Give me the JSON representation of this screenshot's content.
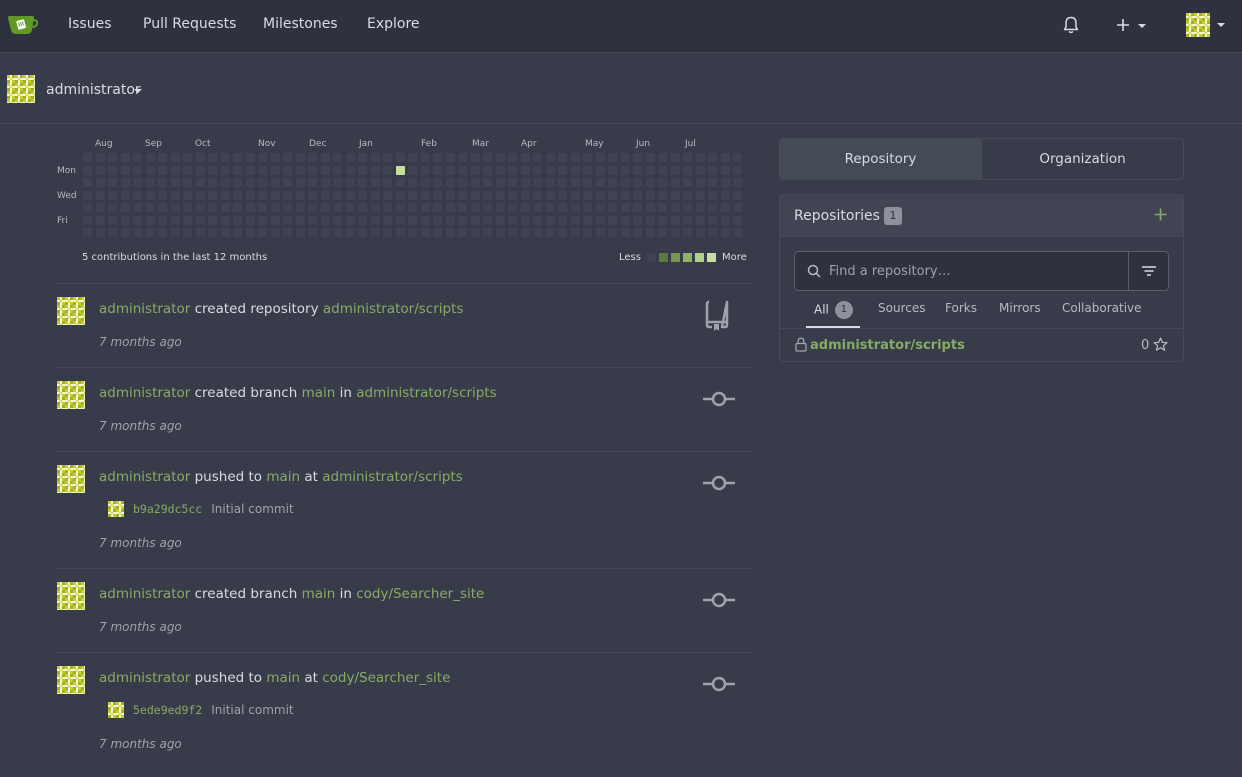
{
  "nav": {
    "items": [
      "Issues",
      "Pull Requests",
      "Milestones",
      "Explore"
    ]
  },
  "context": {
    "user": "administrator"
  },
  "heatmap": {
    "months": [
      "Aug",
      "Sep",
      "Oct",
      "Nov",
      "Dec",
      "Jan",
      "Feb",
      "Mar",
      "Apr",
      "May",
      "Jun",
      "Jul"
    ],
    "days": [
      "Mon",
      "Wed",
      "Fri"
    ],
    "summary": "5 contributions in the last 12 months",
    "less": "Less",
    "more": "More",
    "colors": [
      "#404452",
      "#5c7a3e",
      "#76984f",
      "#90b464",
      "#b0d08a",
      "#c7e09f"
    ],
    "active_cell": {
      "week": 25,
      "day": 1,
      "level": 5
    }
  },
  "feed": [
    {
      "user": "administrator",
      "action": "created repository",
      "target": "administrator/scripts",
      "time": "7 months ago",
      "icon": "repo-icon"
    },
    {
      "user": "administrator",
      "action": "created branch",
      "branch": "main",
      "prep": "in",
      "target": "administrator/scripts",
      "time": "7 months ago",
      "icon": "commit-icon"
    },
    {
      "user": "administrator",
      "action": "pushed to",
      "branch": "main",
      "prep": "at",
      "target": "administrator/scripts",
      "commit_sha": "b9a29dc5cc",
      "commit_msg": "Initial commit",
      "time": "7 months ago",
      "icon": "commit-icon"
    },
    {
      "user": "administrator",
      "action": "created branch",
      "branch": "main",
      "prep": "in",
      "target": "cody/Searcher_site",
      "time": "7 months ago",
      "icon": "commit-icon"
    },
    {
      "user": "administrator",
      "action": "pushed to",
      "branch": "main",
      "prep": "at",
      "target": "cody/Searcher_site",
      "commit_sha": "5ede9ed9f2",
      "commit_msg": "Initial commit",
      "time": "7 months ago",
      "icon": "commit-icon"
    }
  ],
  "dashboard_tabs": [
    "Repository",
    "Organization"
  ],
  "repos": {
    "title": "Repositories",
    "count": "1",
    "search_placeholder": "Find a repository…",
    "filters": {
      "all": "All",
      "all_count": "1",
      "sources": "Sources",
      "forks": "Forks",
      "mirrors": "Mirrors",
      "collaborative": "Collaborative"
    },
    "list": [
      {
        "name": "administrator/scripts",
        "stars": "0",
        "private": true
      }
    ]
  },
  "colors": {
    "accent": "#87ab63",
    "bg": "#383c4a",
    "nav_bg": "#2e323e"
  }
}
